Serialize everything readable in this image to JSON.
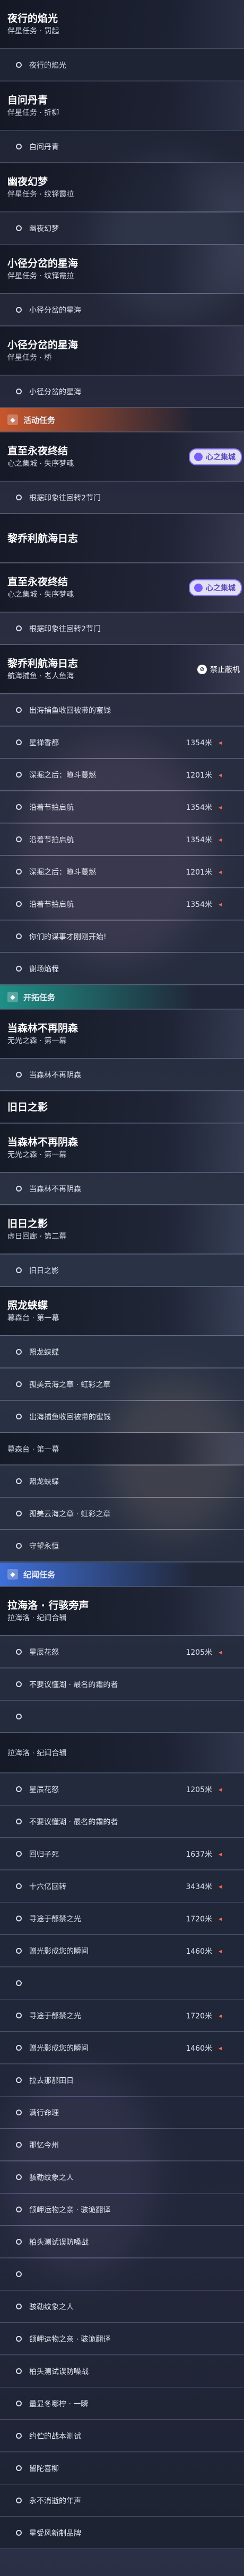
{
  "colors": {
    "event_header_bg": "#c7572c",
    "trailblaze_header_bg": "#1f8f86",
    "penacony_header_bg": "#3f6fd9",
    "lavender_pill": "#7a5cff",
    "arrow_red": "#ff6a4a"
  },
  "rows": [
    {
      "kind": "quest",
      "title": "夜行的焰光",
      "sub": "伴星任务 · 罚起",
      "h": 74
    },
    {
      "kind": "obj",
      "label": "夜行的焰光",
      "h": 48
    },
    {
      "kind": "quest",
      "title": "自问丹青",
      "sub": "伴星任务 · 折柳",
      "h": 74
    },
    {
      "kind": "obj",
      "label": "自问丹青",
      "h": 48
    },
    {
      "kind": "quest",
      "title": "幽夜幻梦",
      "sub": "伴星任务 · 纹铎霞拉",
      "h": 74
    },
    {
      "kind": "obj",
      "label": "幽夜幻梦",
      "h": 48
    },
    {
      "kind": "quest",
      "title": "小径分岔的星海",
      "sub": "伴星任务 · 纹铎霞拉",
      "h": 74
    },
    {
      "kind": "obj",
      "label": "小径分岔的星海",
      "h": 48
    },
    {
      "kind": "quest",
      "title": "小径分岔的星海",
      "sub": "伴星任务 · 桥",
      "h": 74
    },
    {
      "kind": "obj",
      "label": "小径分岔的星海",
      "h": 48
    },
    {
      "kind": "section",
      "label": "活动任务",
      "icon": "event-icon",
      "color": "#c7572c",
      "h": 36
    },
    {
      "kind": "quest",
      "title": "直至永夜终结",
      "sub": "心之集城 · 失序梦魂",
      "h": 74,
      "pill": "心之集城"
    },
    {
      "kind": "obj",
      "label": "根据印象往回转2节门",
      "h": 48
    },
    {
      "kind": "quest",
      "title": "黎乔利航海日志",
      "sub": "",
      "h": 74
    },
    {
      "kind": "quest",
      "title": "直至永夜终结",
      "sub": "心之集城 · 失序梦魂",
      "h": 74,
      "pill": "心之集城"
    },
    {
      "kind": "obj",
      "label": "根据印象往回转2节门",
      "h": 48
    },
    {
      "kind": "quest",
      "title": "黎乔利航海日志",
      "sub": "航海捕鱼 · 老人鱼海",
      "h": 74,
      "stop": "禁止蔽机"
    },
    {
      "kind": "obj",
      "label": "出海捕鱼收回被带的蜜饯",
      "h": 48
    },
    {
      "kind": "obj",
      "label": "星禅香都",
      "h": 48,
      "dist": "1354米"
    },
    {
      "kind": "obj",
      "label": "深掘之后：瞭斗蔓燃",
      "h": 48,
      "dist": "1201米"
    },
    {
      "kind": "obj",
      "label": "沿着节拍启航",
      "h": 48,
      "dist": "1354米"
    },
    {
      "kind": "obj",
      "label": "沿着节拍启航",
      "h": 48,
      "dist": "1354米"
    },
    {
      "kind": "obj",
      "label": "深掘之后：瞭斗蔓燃",
      "h": 48,
      "dist": "1201米"
    },
    {
      "kind": "obj",
      "label": "沿着节拍启航",
      "h": 48,
      "dist": "1354米"
    },
    {
      "kind": "obj",
      "label": "你们的谋事才刚刚开始!",
      "h": 48
    },
    {
      "kind": "obj",
      "label": "谢场焰程",
      "h": 48
    },
    {
      "kind": "section",
      "label": "开拓任务",
      "icon": "trailblaze-icon",
      "color": "#1f8f86",
      "h": 36
    },
    {
      "kind": "quest",
      "title": "当森林不再阴森",
      "sub": "无光之森 · 第一幕",
      "h": 74
    },
    {
      "kind": "obj",
      "label": "当森林不再阴森",
      "h": 48
    },
    {
      "kind": "quest",
      "title": "旧日之影",
      "sub": "",
      "h": 48
    },
    {
      "kind": "quest",
      "title": "当森林不再阴森",
      "sub": "无光之森 · 第一幕",
      "h": 74
    },
    {
      "kind": "obj",
      "label": "当森林不再阴森",
      "h": 48
    },
    {
      "kind": "quest",
      "title": "旧日之影",
      "sub": "虚日回廊 · 第二幕",
      "h": 74
    },
    {
      "kind": "obj",
      "label": "旧日之影",
      "h": 48
    },
    {
      "kind": "quest",
      "title": "照龙蛱蝶",
      "sub": "幕森台 · 第一幕",
      "h": 74
    },
    {
      "kind": "obj",
      "label": "照龙蛱蝶",
      "h": 48
    },
    {
      "kind": "obj",
      "label": "孤美云海之章 · 虹彩之章",
      "h": 48
    },
    {
      "kind": "obj",
      "label": "出海捕鱼收回被带的蜜饯",
      "h": 48
    },
    {
      "kind": "quest",
      "title": "",
      "sub": "幕森台 · 第一幕",
      "h": 48
    },
    {
      "kind": "obj",
      "label": "照龙蛱蝶",
      "h": 48
    },
    {
      "kind": "obj",
      "label": "孤美云海之章 · 虹彩之章",
      "h": 48
    },
    {
      "kind": "obj",
      "label": "守望永恒",
      "h": 48
    },
    {
      "kind": "section",
      "label": "纪闻任务",
      "icon": "penacony-icon",
      "color": "#3f6fd9",
      "h": 36
    },
    {
      "kind": "quest",
      "title": "拉海洛 · 行骇旁声",
      "sub": "拉海洛 · 纪闻合辑",
      "h": 74
    },
    {
      "kind": "obj",
      "label": "星辰花怒",
      "h": 48,
      "dist": "1205米"
    },
    {
      "kind": "obj",
      "label": "不要议懂湖 · 最名的霜的者",
      "h": 48
    },
    {
      "kind": "obj",
      "label": "",
      "h": 48
    },
    {
      "kind": "quest",
      "title": "",
      "sub": "拉海洛 · 纪闻合辑",
      "h": 60
    },
    {
      "kind": "obj",
      "label": "星辰花怒",
      "h": 48,
      "dist": "1205米"
    },
    {
      "kind": "obj",
      "label": "不要议懂湖 · 最名的霜的者",
      "h": 48
    },
    {
      "kind": "obj",
      "label": "回归子死",
      "h": 48,
      "dist": "1637米"
    },
    {
      "kind": "obj",
      "label": "十六亿回转",
      "h": 48,
      "dist": "3434米"
    },
    {
      "kind": "obj",
      "label": "寻途于郁禁之光",
      "h": 48,
      "dist": "1720米"
    },
    {
      "kind": "obj",
      "label": "赠光影成您的瞬间",
      "h": 48,
      "dist": "1460米"
    },
    {
      "kind": "obj",
      "label": "",
      "h": 48
    },
    {
      "kind": "obj",
      "label": "寻途于郁禁之光",
      "h": 48,
      "dist": "1720米"
    },
    {
      "kind": "obj",
      "label": "赠光影成您的瞬间",
      "h": 48,
      "dist": "1460米"
    },
    {
      "kind": "obj",
      "label": "拉去那那田日",
      "h": 48
    },
    {
      "kind": "obj",
      "label": "满行命理",
      "h": 48
    },
    {
      "kind": "obj",
      "label": "那忆今州",
      "h": 48
    },
    {
      "kind": "obj",
      "label": "骇勒纹象之人",
      "h": 48
    },
    {
      "kind": "obj",
      "label": "颌岬运物之亲 · 骇诡翻译",
      "h": 48
    },
    {
      "kind": "obj",
      "label": "柏头测试误防嗓战",
      "h": 48
    },
    {
      "kind": "obj",
      "label": "",
      "h": 48
    },
    {
      "kind": "obj",
      "label": "骇勒纹象之人",
      "h": 48
    },
    {
      "kind": "obj",
      "label": "颌岬运物之亲 · 骇诡翻译",
      "h": 48
    },
    {
      "kind": "obj",
      "label": "柏头测试误防嗓战",
      "h": 48
    },
    {
      "kind": "obj",
      "label": "量显冬哪柠 · 一瞬",
      "h": 48
    },
    {
      "kind": "obj",
      "label": "约伫的战本测试",
      "h": 48
    },
    {
      "kind": "obj",
      "label": "留陀喜柳",
      "h": 48
    },
    {
      "kind": "obj",
      "label": "永不消逝的年声",
      "h": 48
    },
    {
      "kind": "obj",
      "label": "星受风新制品牌",
      "h": 48
    }
  ]
}
